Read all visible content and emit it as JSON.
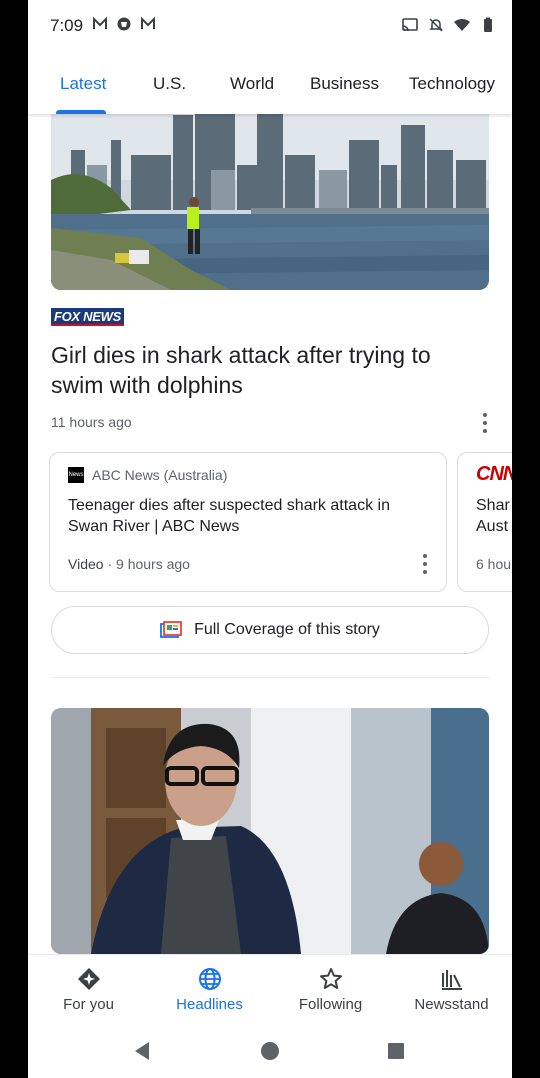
{
  "status_bar": {
    "time": "7:09"
  },
  "tabs": [
    {
      "label": "Latest"
    },
    {
      "label": "U.S."
    },
    {
      "label": "World"
    },
    {
      "label": "Business"
    },
    {
      "label": "Technology"
    }
  ],
  "story1": {
    "source": "FOX NEWS",
    "headline": "Girl dies in shark attack after trying to swim with dolphins",
    "time": "11 hours ago",
    "related": [
      {
        "publisher": "ABC News (Australia)",
        "title": "Teenager dies after suspected shark attack in Swan River | ABC News",
        "type": "Video",
        "time": "9 hours ago"
      },
      {
        "publisher": "CNN",
        "title": "Shar\nAust",
        "time": "6 hou"
      }
    ],
    "full_coverage_label": "Full Coverage of this story"
  },
  "bottom_nav": [
    {
      "label": "For you",
      "icon": "for-you-icon"
    },
    {
      "label": "Headlines",
      "icon": "globe-icon"
    },
    {
      "label": "Following",
      "icon": "star-icon"
    },
    {
      "label": "Newsstand",
      "icon": "newsstand-icon"
    }
  ],
  "colors": {
    "accent": "#1a73e8",
    "fox_blue": "#1b3a7a",
    "cnn_red": "#cc0000"
  }
}
